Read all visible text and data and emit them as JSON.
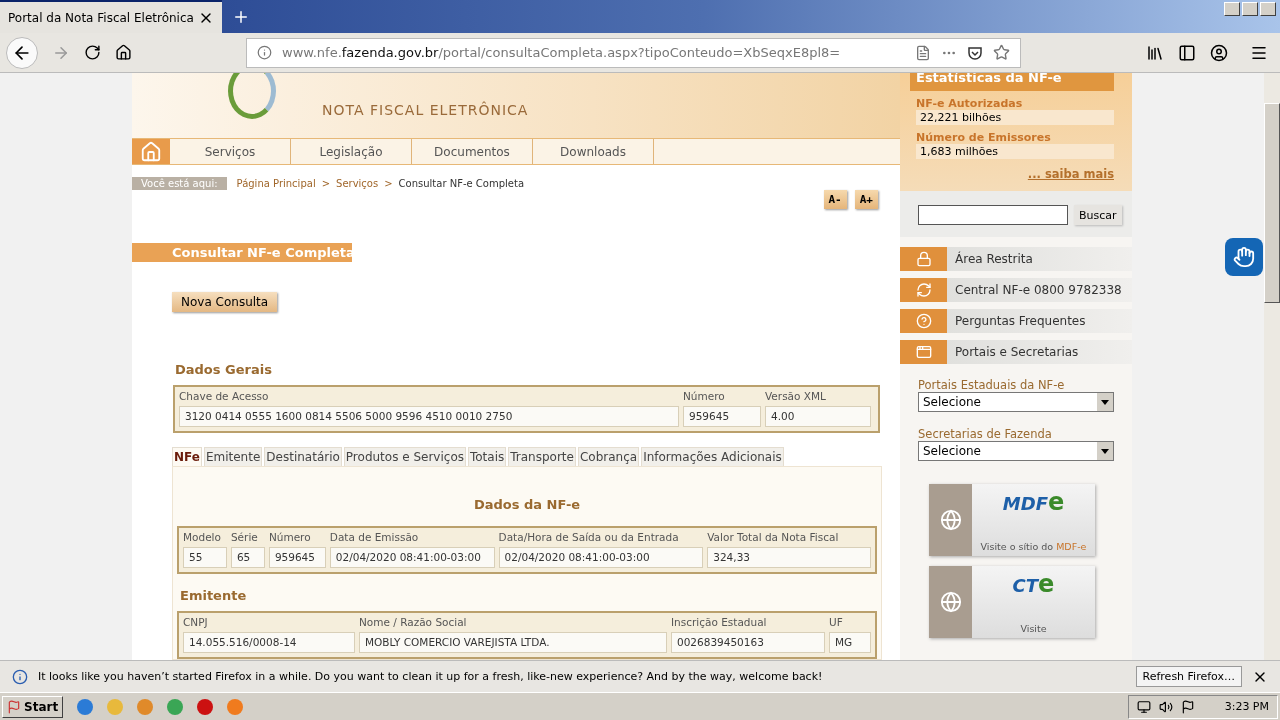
{
  "browser": {
    "tab_title": "Portal da Nota Fiscal Eletrônica",
    "url": "www.nfe.**fazenda.gov.br**/portal/consultaCompleta.aspx?tipoConteudo=XbSeqxE8pl8="
  },
  "header": {
    "banner_title": "NOTA FISCAL ELETRÔNICA",
    "nav": [
      "Serviços",
      "Legislação",
      "Documentos",
      "Downloads"
    ]
  },
  "breadcrumb": {
    "label": "Você está aqui:",
    "items": [
      {
        "kind": "link",
        "text": "Página Principal"
      },
      {
        "kind": "separator",
        "text": ">"
      },
      {
        "kind": "link",
        "text": "Serviços"
      },
      {
        "kind": "separator",
        "text": ">"
      },
      {
        "kind": "current",
        "text": "Consultar NF-e Completa"
      }
    ]
  },
  "font_buttons": [
    "A-",
    "A+"
  ],
  "page_title": "Consultar NF-e Completa",
  "new_query_button": "Nova Consulta",
  "general": {
    "title": "Dados Gerais",
    "fields": [
      {
        "label": "Chave de Acesso",
        "value": "3120 0414 0555 1600 0814 5506 5000 9596 4510 0010 2750"
      },
      {
        "label": "Número",
        "value": "959645"
      },
      {
        "label": "Versão XML",
        "value": "4.00"
      }
    ]
  },
  "tabs": [
    {
      "label": "NFe",
      "selected": true
    },
    {
      "label": "Emitente",
      "selected": false
    },
    {
      "label": "Destinatário",
      "selected": false
    },
    {
      "label": "Produtos e Serviços",
      "selected": false
    },
    {
      "label": "Totais",
      "selected": false
    },
    {
      "label": "Transporte",
      "selected": false
    },
    {
      "label": "Cobrança",
      "selected": false
    },
    {
      "label": "Informações Adicionais",
      "selected": false
    }
  ],
  "panel": {
    "title": "Dados da NF-e",
    "fields": [
      {
        "label": "Modelo",
        "value": "55"
      },
      {
        "label": "Série",
        "value": "65"
      },
      {
        "label": "Número",
        "value": "959645"
      },
      {
        "label": "Data de Emissão",
        "value": "02/04/2020 08:41:00-03:00"
      },
      {
        "label": "Data/Hora de Saída ou da Entrada",
        "value": "02/04/2020 08:41:00-03:00"
      },
      {
        "label": "Valor Total da Nota Fiscal",
        "value": "324,33"
      }
    ],
    "issuer_title": "Emitente",
    "issuer_fields": [
      {
        "label": "CNPJ",
        "value": "14.055.516/0008-14"
      },
      {
        "label": "Nome / Razão Social",
        "value": "MOBLY COMERCIO VAREJISTA LTDA."
      },
      {
        "label": "Inscrição Estadual",
        "value": "0026839450163"
      },
      {
        "label": "UF",
        "value": "MG"
      }
    ]
  },
  "sidebar": {
    "stats_title": "Estatísticas da NF-e",
    "stats": [
      {
        "label": "NF-e Autorizadas",
        "value": "22,221 bilhões"
      },
      {
        "label": "Número de Emissores",
        "value": "1,683 milhões"
      }
    ],
    "more_link": "... saiba mais",
    "search_button": "Buscar",
    "links": [
      {
        "kind": "lock",
        "label": "Área Restrita"
      },
      {
        "kind": "refresh",
        "label": "Central NF-e 0800 9782338"
      },
      {
        "kind": "question",
        "label": "Perguntas Frequentes"
      },
      {
        "kind": "window",
        "label": "Portais e Secretarias"
      }
    ],
    "selects": [
      {
        "label": "Portais Estaduais da NF-e",
        "value": "Selecione"
      },
      {
        "label": "Secretarias de Fazenda",
        "value": "Selecione"
      }
    ],
    "banners": [
      {
        "logo": "MDF",
        "logo_mark": "e",
        "caption": "Visite o sítio do **MDF-e**"
      },
      {
        "logo": "CT",
        "logo_mark": "e",
        "caption": "Visite"
      }
    ]
  },
  "notification": {
    "text": "It looks like you haven’t started Firefox in a while. Do you want to clean it up for a fresh, like-new experience? And by the way, welcome back!",
    "button": "Refresh Firefox…"
  },
  "taskbar": {
    "start": "Start",
    "clock": "3:23 PM"
  }
}
